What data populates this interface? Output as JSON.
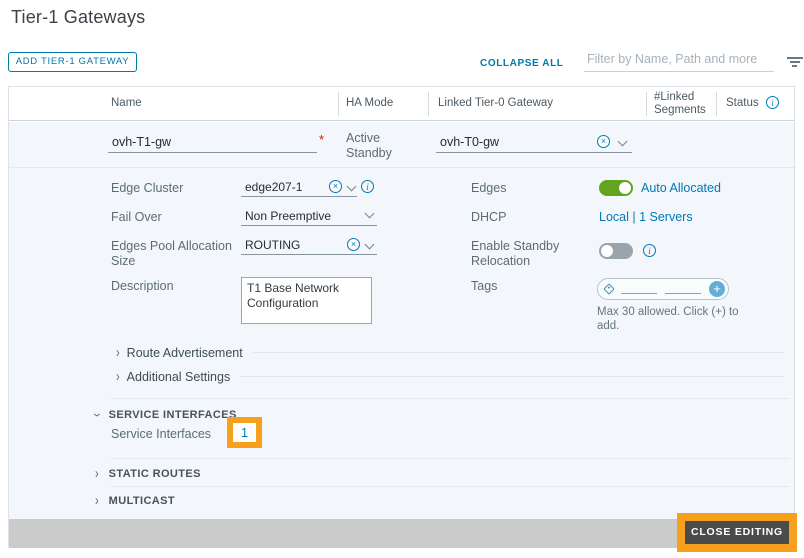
{
  "page": {
    "title": "Tier-1 Gateways"
  },
  "toolbar": {
    "add_button": "ADD TIER-1 GATEWAY",
    "collapse_all": "COLLAPSE ALL",
    "filter_placeholder": "Filter by Name, Path and more"
  },
  "table": {
    "columns": {
      "name": "Name",
      "ha_mode": "HA Mode",
      "linked_tier0": "Linked Tier-0 Gateway",
      "linked_segments": "#Linked Segments",
      "status": "Status"
    }
  },
  "editor": {
    "name_value": "ovh-T1-gw",
    "required_marker": "*",
    "ha_mode_value": "Active Standby",
    "linked_tier0_value": "ovh-T0-gw",
    "edge_cluster_label": "Edge Cluster",
    "edge_cluster_value": "edge207-1",
    "fail_over_label": "Fail Over",
    "fail_over_value": "Non Preemptive",
    "pool_label": "Edges Pool Allocation Size",
    "pool_value": "ROUTING",
    "description_label": "Description",
    "description_value": "T1 Base Network Configuration",
    "edges_label": "Edges",
    "edges_value": "Auto Allocated",
    "dhcp_label": "DHCP",
    "dhcp_value": "Local | 1 Servers",
    "standby_label": "Enable Standby Relocation",
    "tags_label": "Tags",
    "tags_hint": "Max 30 allowed. Click (+) to add.",
    "sections": {
      "route_advertisement": "Route Advertisement",
      "additional_settings": "Additional Settings",
      "service_interfaces_title": "SERVICE INTERFACES",
      "service_interfaces_label": "Service Interfaces",
      "service_interfaces_count": "1",
      "static_routes": "STATIC ROUTES",
      "multicast": "MULTICAST"
    },
    "close_editing": "CLOSE EDITING"
  },
  "colors": {
    "accent_blue": "#0079ad",
    "link_blue": "#0079b8",
    "toggle_on_green": "#62a420",
    "toggle_off_gray": "#9aa4ac",
    "annotation_orange": "#f7a01e",
    "required_red": "#c92100",
    "footer_gray": "#cbcbcb"
  }
}
